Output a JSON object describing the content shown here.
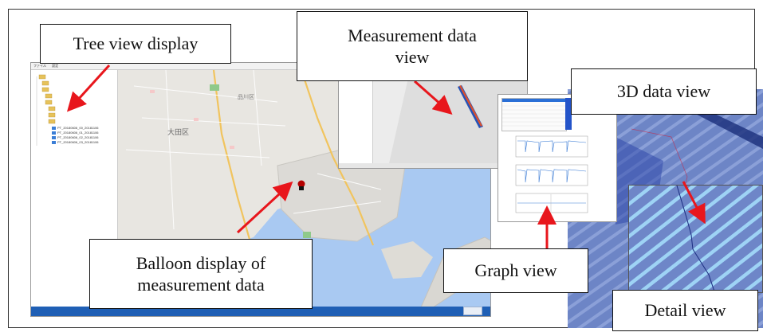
{
  "callouts": {
    "tree_view": "Tree view display",
    "measurement_view_line1": "Measurement data",
    "measurement_view_line2": "view",
    "data3d_view": "3D data view",
    "balloon_line1": "Balloon display of",
    "balloon_line2": "measurement data",
    "graph_view": "Graph view",
    "detail_view": "Detail view"
  },
  "main_window": {
    "menu": [
      "ファイル",
      "設定"
    ],
    "tree_items": [
      "PT_20180606_00_20181106",
      "PT_20180606_01_20181106",
      "PT_20180606_02_20181106",
      "PT_20180606_03_20181106"
    ],
    "map_labels": [
      "大田区",
      "品川区"
    ]
  },
  "colors": {
    "taskbar": "#1f5fb5",
    "arrow": "#e8161c",
    "water": "#a9c9f2",
    "land": "#e8e6e1",
    "surface": "#6f87c9",
    "stripe": "#9ed3f5"
  }
}
